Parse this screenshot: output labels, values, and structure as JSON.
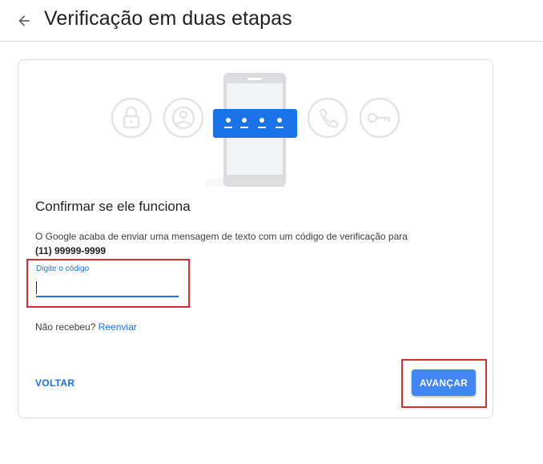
{
  "header": {
    "title": "Verificação em duas etapas",
    "back_icon": "arrow-back-icon"
  },
  "illustration": {
    "icons": [
      "lock-icon",
      "account-circle-icon",
      "phone-icon",
      "key-icon"
    ],
    "code_dots": 4
  },
  "card": {
    "heading": "Confirmar se ele funciona",
    "description": "O Google acaba de enviar uma mensagem de texto com um código de verificação para",
    "phone_number": "(11) 99999-9999",
    "code_field": {
      "label": "Digite o código",
      "value": ""
    },
    "resend_prompt": "Não recebeu?",
    "resend_link": "Reenviar",
    "back_label": "VOLTAR",
    "next_label": "AVANÇAR"
  },
  "colors": {
    "accent": "#1a73e8",
    "button": "#4285f4",
    "highlight": "#d32f2f",
    "icon_gray": "#e0e0e0"
  }
}
